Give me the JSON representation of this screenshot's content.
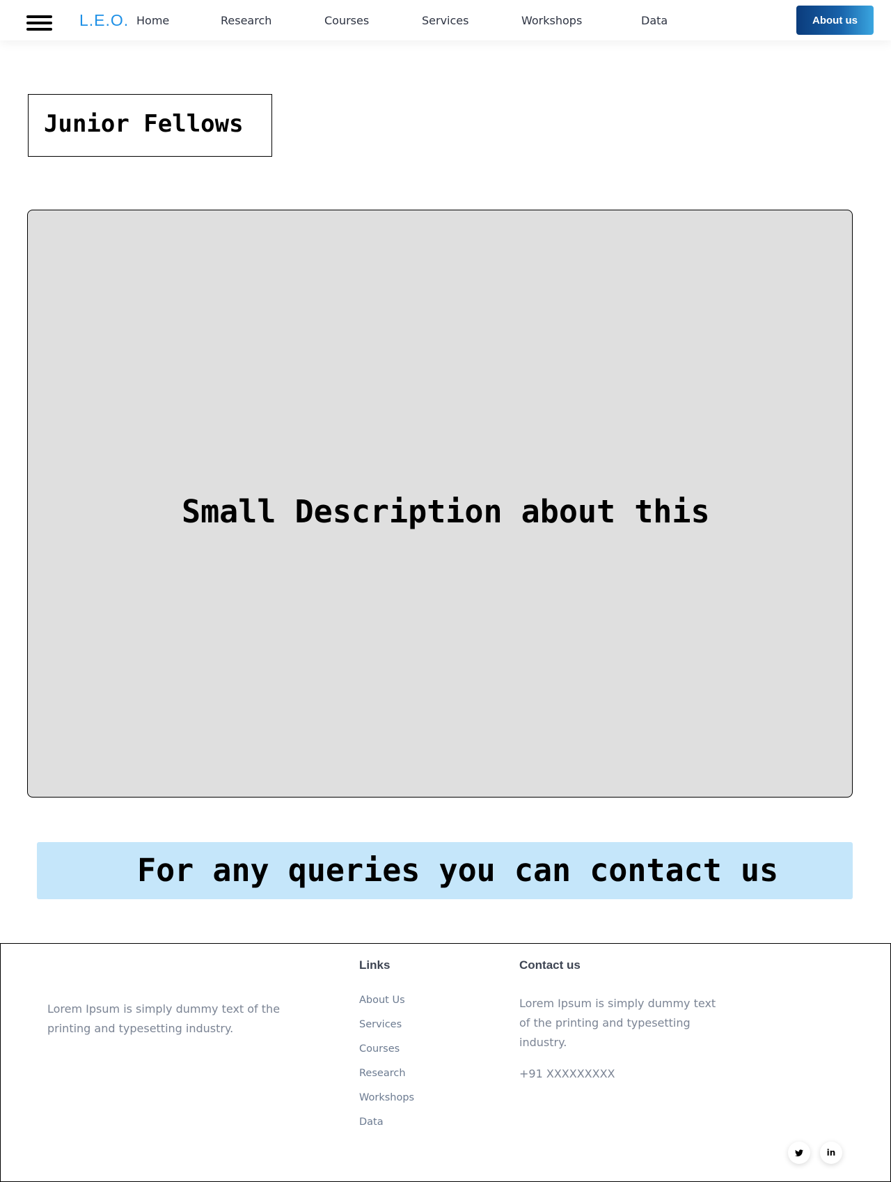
{
  "header": {
    "logo": "L.E.O.",
    "nav": [
      "Home",
      "Research",
      "Courses",
      "Services",
      "Workshops",
      "Data"
    ],
    "about_button": "About us"
  },
  "page": {
    "title": "Junior Fellows",
    "description": "Small Description about this",
    "contact_banner": "For any queries you can contact us"
  },
  "footer": {
    "about_text": "Lorem Ipsum is simply dummy text of the printing and typesetting industry.",
    "links_heading": "Links",
    "links": [
      "About Us",
      "Services",
      "Courses",
      "Research",
      "Workshops",
      "Data"
    ],
    "contact_heading": "Contact us",
    "contact_text": "Lorem Ipsum is simply dummy text of the printing and typesetting industry.",
    "phone": "+91 XXXXXXXXX",
    "social": {
      "twitter": "twitter-icon",
      "linkedin": "linkedin-icon",
      "linkedin_label": "in"
    }
  },
  "colors": {
    "logo": "#1e90e6",
    "button_gradient_start": "#0b3c7c",
    "button_gradient_end": "#3aa6e0",
    "card_bg": "#dfdfdf",
    "banner_bg": "#c5e6fa"
  }
}
